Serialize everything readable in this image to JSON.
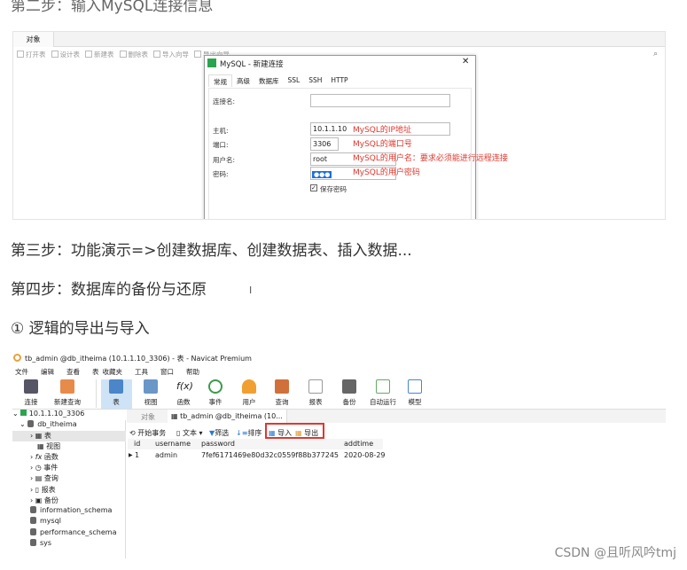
{
  "headings": {
    "step2": "第二步：输入MySQL连接信息",
    "step3": "第三步：功能演示=>创建数据库、创建数据表、插入数据...",
    "step4": "第四步：数据库的备份与还原",
    "sub1": "① 逻辑的导出与导入"
  },
  "shot1": {
    "tab": "对象",
    "toolbar": [
      "打开表",
      "设计表",
      "新建表",
      "删除表",
      "导入向导",
      "导出向导"
    ],
    "dialog": {
      "title": "MySQL - 新建连接",
      "close": "✕",
      "tabs": [
        "常规",
        "高级",
        "数据库",
        "SSL",
        "SSH",
        "HTTP"
      ],
      "fields": {
        "conn_name_label": "连接名:",
        "conn_name": "",
        "host_label": "主机:",
        "host": "10.1.1.10",
        "port_label": "端口:",
        "port": "3306",
        "user_label": "用户名:",
        "user": "root",
        "pwd_label": "密码:",
        "pwd": "●●●",
        "save_pwd": "保存密码"
      },
      "notes": {
        "host": "MySQL的IP地址",
        "port": "MySQL的端口号",
        "user": "MySQL的用户名：要求必须能进行远程连接",
        "pwd": "MySQL的用户密码"
      }
    }
  },
  "shot2": {
    "title": "tb_admin @db_itheima (10.1.1.10_3306) - 表 - Navicat Premium",
    "menu": [
      "文件",
      "编辑",
      "查看",
      "表",
      "收藏夹",
      "工具",
      "窗口",
      "帮助"
    ],
    "toolbar": [
      "连接",
      "新建查询",
      "表",
      "视图",
      "函数",
      "事件",
      "用户",
      "查询",
      "报表",
      "备份",
      "自动运行",
      "模型"
    ],
    "tree": {
      "conn": "10.1.1.10_3306",
      "db": "db_itheima",
      "items": [
        "表",
        "视图",
        "函数",
        "事件",
        "查询",
        "报表",
        "备份"
      ],
      "dbs": [
        "information_schema",
        "mysql",
        "performance_schema",
        "sys"
      ]
    },
    "tabs": [
      "对象",
      "tb_admin @db_itheima (10..."
    ],
    "actions": {
      "begin": "开始事务",
      "text": "文本",
      "filter": "筛选",
      "sort": "排序",
      "import": "导入",
      "export": "导出"
    },
    "columns": [
      "id",
      "username",
      "password",
      "addtime"
    ],
    "rows": [
      [
        "1",
        "admin",
        "7fef6171469e80d32c0559f88b377245",
        "2020-08-29"
      ]
    ]
  },
  "watermark": "CSDN @且听风吟tmj",
  "colors": {
    "annotation": "#e0372e",
    "highlight_box": "#e0372e",
    "selected": "#cfe3f7"
  }
}
